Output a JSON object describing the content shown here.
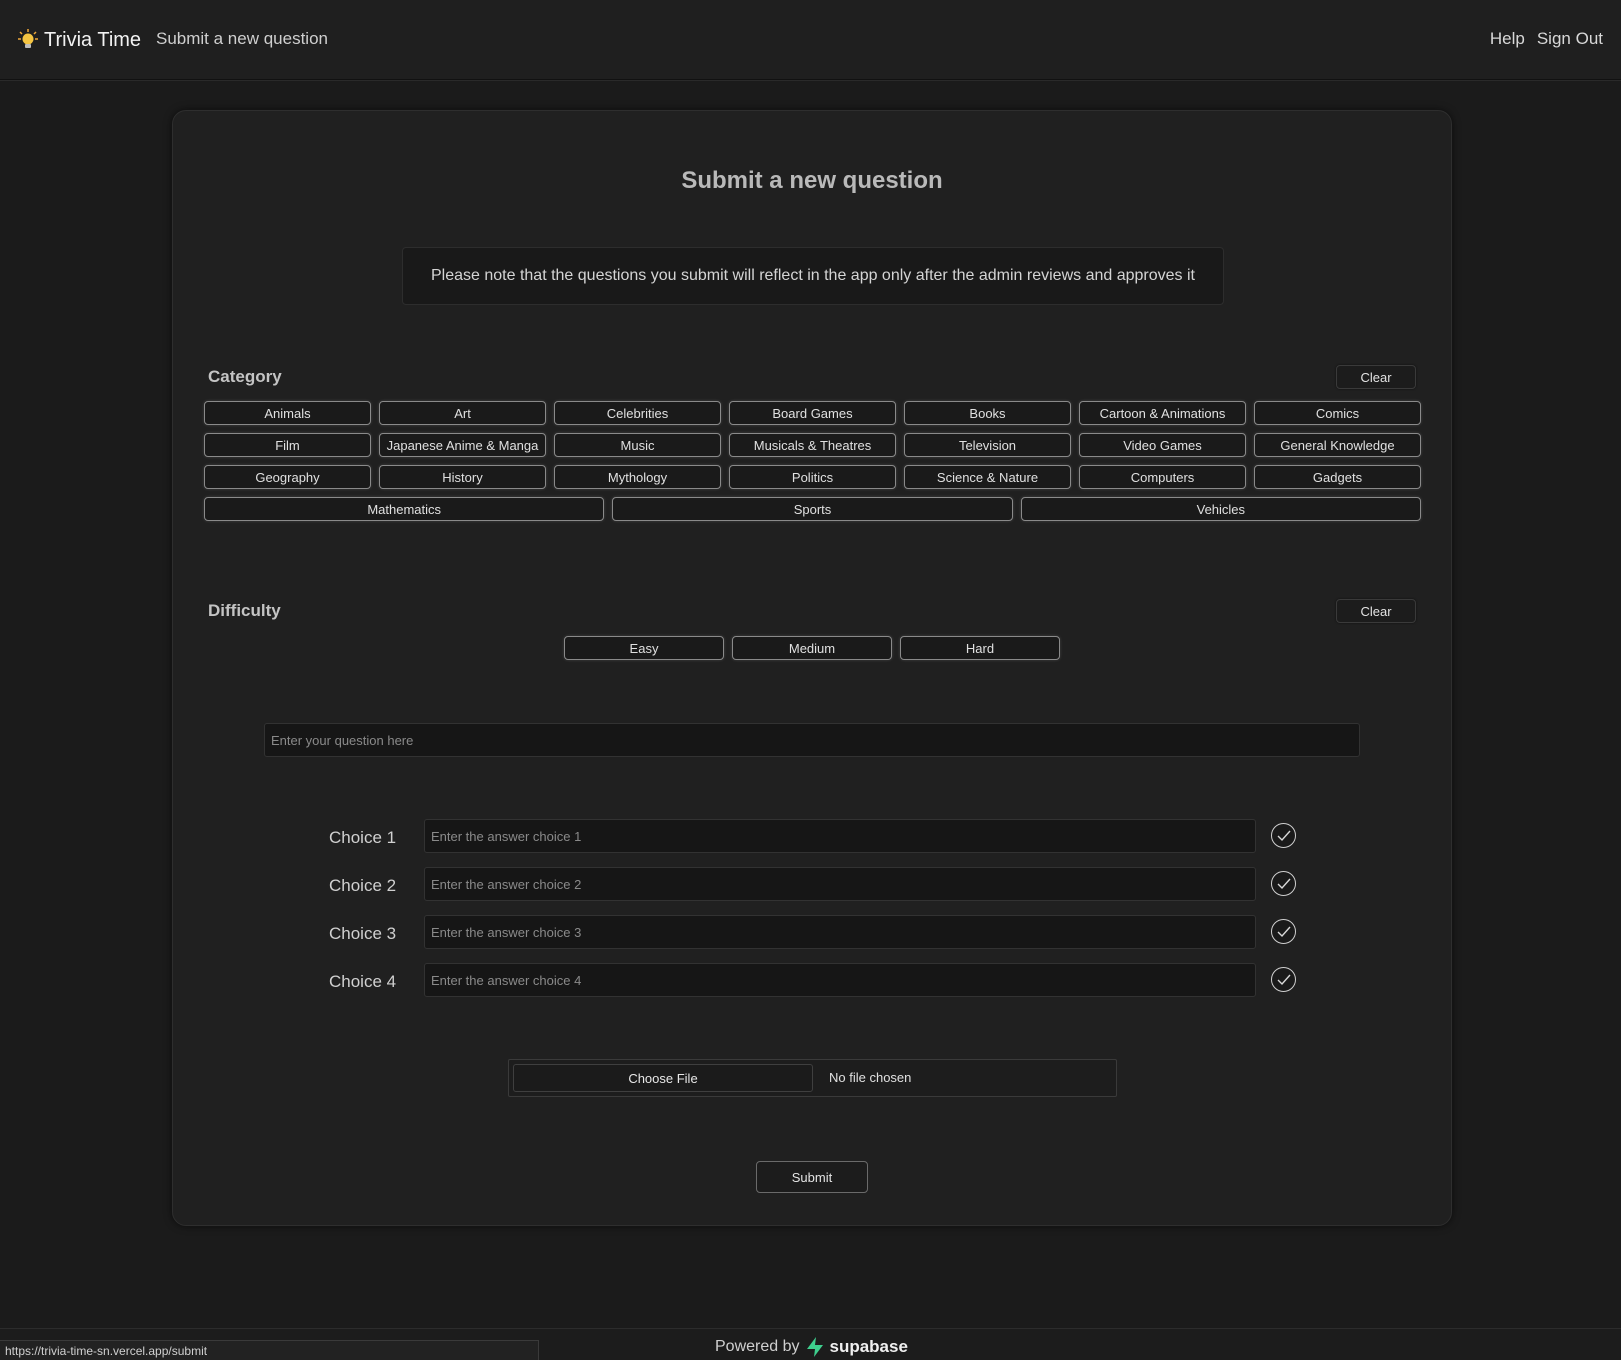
{
  "header": {
    "brand": "Trivia Time",
    "subtitle": "Submit a new question",
    "nav": [
      "Help",
      "Sign Out"
    ]
  },
  "main": {
    "title": "Submit a new question",
    "note": "Please note that the questions you submit will reflect in the app only after the admin reviews and approves it",
    "category": {
      "label": "Category",
      "clear": "Clear",
      "rows": [
        [
          "Animals",
          "Art",
          "Celebrities",
          "Board Games",
          "Books",
          "Cartoon & Animations",
          "Comics"
        ],
        [
          "Film",
          "Japanese Anime & Manga",
          "Music",
          "Musicals & Theatres",
          "Television",
          "Video Games",
          "General Knowledge"
        ],
        [
          "Geography",
          "History",
          "Mythology",
          "Politics",
          "Science & Nature",
          "Computers",
          "Gadgets"
        ],
        [
          "Mathematics",
          "Sports",
          "Vehicles"
        ]
      ]
    },
    "difficulty": {
      "label": "Difficulty",
      "clear": "Clear",
      "options": [
        "Easy",
        "Medium",
        "Hard"
      ]
    },
    "question": {
      "placeholder": "Enter your question here",
      "value": ""
    },
    "choices": [
      {
        "label": "Choice 1",
        "placeholder": "Enter the answer choice 1"
      },
      {
        "label": "Choice 2",
        "placeholder": "Enter the answer choice 2"
      },
      {
        "label": "Choice 3",
        "placeholder": "Enter the answer choice 3"
      },
      {
        "label": "Choice 4",
        "placeholder": "Enter the answer choice 4"
      }
    ],
    "file": {
      "button": "Choose File",
      "status": "No file chosen"
    },
    "submit": "Submit"
  },
  "footer": {
    "powered_by": "Powered by",
    "brand": "supabase",
    "brand_color": "#3ecf8e"
  },
  "status_url": "https://trivia-time-sn.vercel.app/submit"
}
